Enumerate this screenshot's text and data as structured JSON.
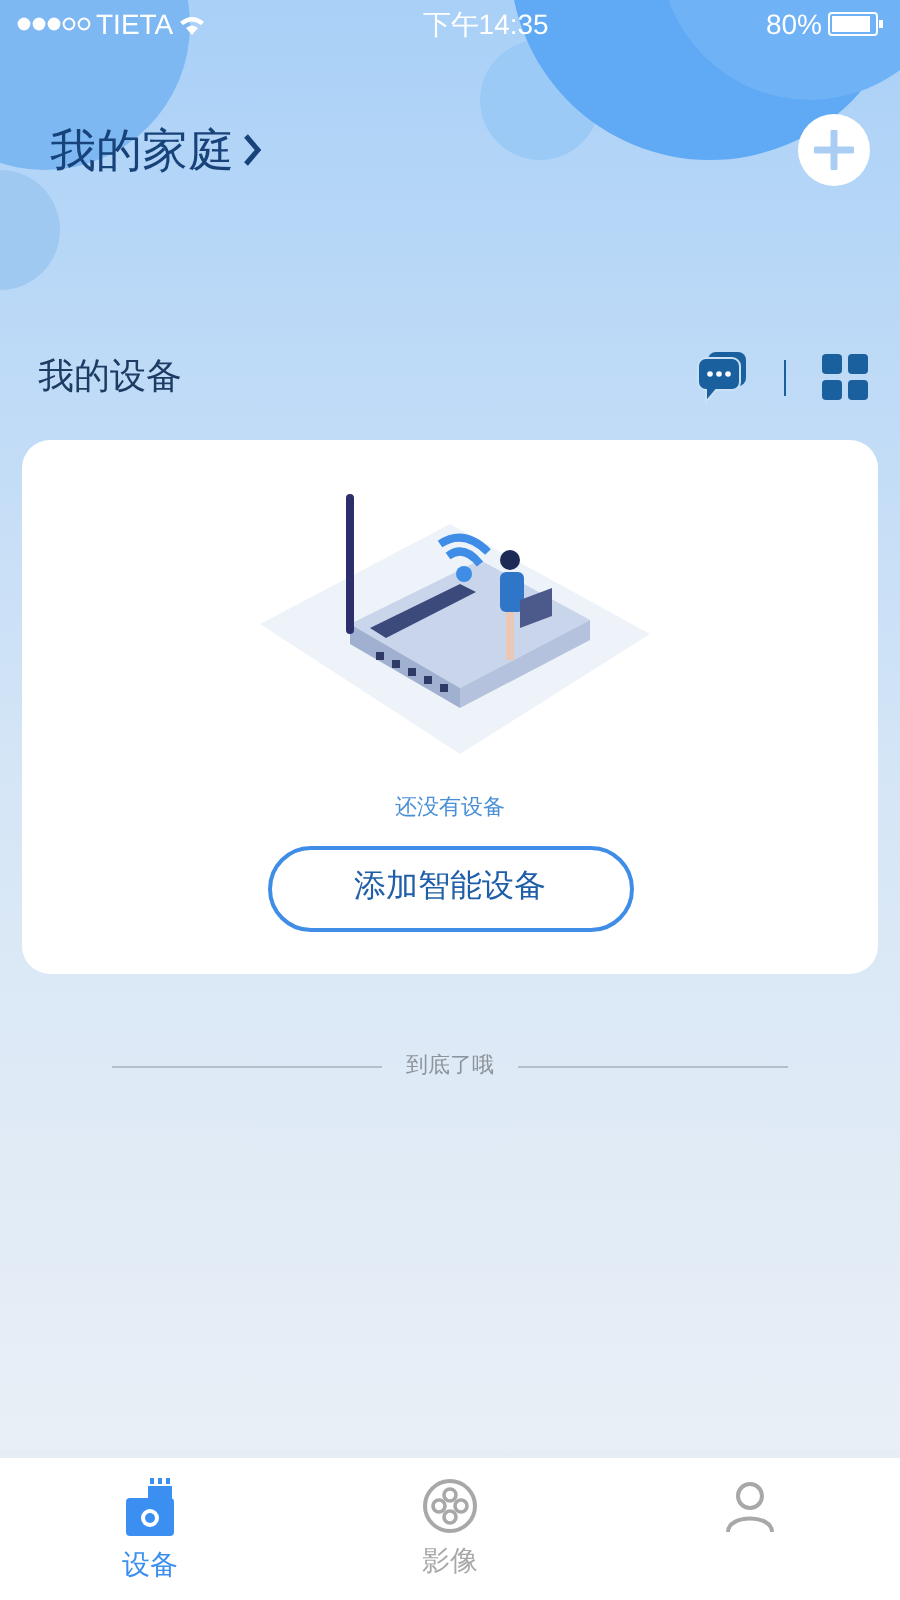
{
  "status_bar": {
    "carrier": "TIETA",
    "time": "下午14:35",
    "battery": "80%"
  },
  "header": {
    "title": "我的家庭"
  },
  "devices_section": {
    "title": "我的设备"
  },
  "empty_card": {
    "message": "还没有设备",
    "button": "添加智能设备"
  },
  "footer_note": "到底了哦",
  "tab_bar": [
    {
      "kind": "device",
      "label": "设备",
      "selected": true
    },
    {
      "kind": "media",
      "label": "影像",
      "selected": false
    },
    {
      "kind": "profile",
      "selected": false
    }
  ]
}
